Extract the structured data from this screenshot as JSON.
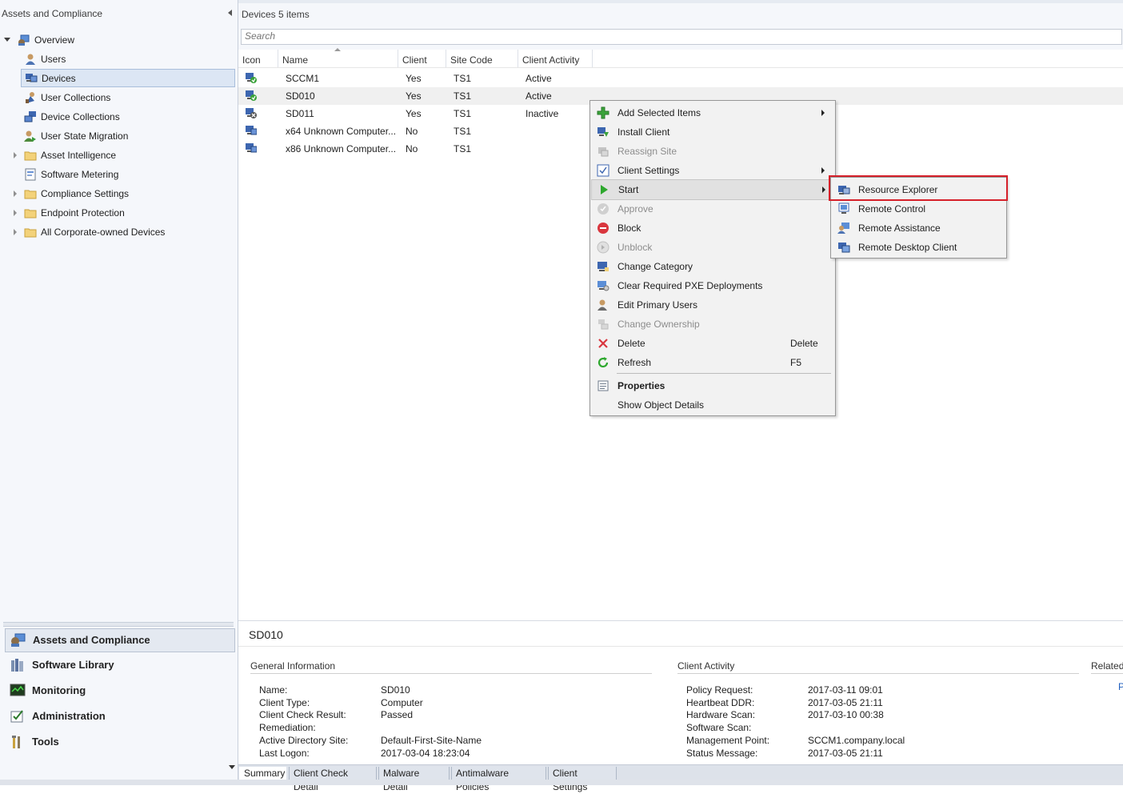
{
  "left_pane": {
    "title": "Assets and Compliance",
    "tree": [
      {
        "label": "Overview",
        "icon": "overview-icon"
      },
      {
        "label": "Users",
        "icon": "user-icon"
      },
      {
        "label": "Devices",
        "icon": "devices-icon",
        "selected": true
      },
      {
        "label": "User Collections",
        "icon": "user-collections-icon"
      },
      {
        "label": "Device Collections",
        "icon": "device-collections-icon"
      },
      {
        "label": "User State Migration",
        "icon": "user-state-migration-icon"
      },
      {
        "label": "Asset Intelligence",
        "icon": "folder-icon"
      },
      {
        "label": "Software Metering",
        "icon": "software-metering-icon"
      },
      {
        "label": "Compliance Settings",
        "icon": "folder-icon"
      },
      {
        "label": "Endpoint Protection",
        "icon": "folder-icon"
      },
      {
        "label": "All Corporate-owned Devices",
        "icon": "folder-icon"
      }
    ]
  },
  "wunderbar": [
    {
      "label": "Assets and Compliance",
      "icon": "assets-compliance-icon",
      "selected": true
    },
    {
      "label": "Software Library",
      "icon": "software-library-icon"
    },
    {
      "label": "Monitoring",
      "icon": "monitoring-icon"
    },
    {
      "label": "Administration",
      "icon": "administration-icon"
    },
    {
      "label": "Tools",
      "icon": "tools-icon"
    }
  ],
  "list": {
    "title": "Devices 5 items",
    "search_placeholder": "Search",
    "columns": [
      "Icon",
      "Name",
      "Client",
      "Site Code",
      "Client Activity"
    ],
    "rows": [
      {
        "name": "SCCM1",
        "client": "Yes",
        "site": "TS1",
        "activity": "Active",
        "icon": "computer-ok-icon"
      },
      {
        "name": "SD010",
        "client": "Yes",
        "site": "TS1",
        "activity": "Active",
        "icon": "computer-ok-icon",
        "selected": true
      },
      {
        "name": "SD011",
        "client": "Yes",
        "site": "TS1",
        "activity": "Inactive",
        "icon": "computer-inactive-icon"
      },
      {
        "name": "x64 Unknown Computer...",
        "client": "No",
        "site": "TS1",
        "activity": "",
        "icon": "computer-icon"
      },
      {
        "name": "x86 Unknown Computer...",
        "client": "No",
        "site": "TS1",
        "activity": "",
        "icon": "computer-icon"
      }
    ]
  },
  "context_menu": {
    "items": [
      {
        "label": "Add Selected Items",
        "icon": "add-icon",
        "submenu": true
      },
      {
        "label": "Install Client",
        "icon": "install-client-icon"
      },
      {
        "label": "Reassign Site",
        "icon": "reassign-site-icon",
        "disabled": true
      },
      {
        "label": "Client Settings",
        "icon": "client-settings-icon",
        "submenu": true
      },
      {
        "label": "Start",
        "icon": "start-icon",
        "submenu": true,
        "highlighted": true
      },
      {
        "label": "Approve",
        "icon": "approve-icon",
        "disabled": true
      },
      {
        "label": "Block",
        "icon": "block-icon"
      },
      {
        "label": "Unblock",
        "icon": "unblock-icon",
        "disabled": true
      },
      {
        "label": "Change Category",
        "icon": "change-category-icon"
      },
      {
        "label": "Clear Required PXE Deployments",
        "icon": "clear-pxe-icon"
      },
      {
        "label": "Edit Primary Users",
        "icon": "edit-users-icon"
      },
      {
        "label": "Change Ownership",
        "icon": "change-ownership-icon",
        "disabled": true
      },
      {
        "label": "Delete",
        "icon": "delete-icon",
        "shortcut": "Delete"
      },
      {
        "label": "Refresh",
        "icon": "refresh-icon",
        "shortcut": "F5"
      },
      {
        "label": "Properties",
        "icon": "properties-icon",
        "bold": true
      },
      {
        "label": "Show Object Details",
        "icon": ""
      }
    ]
  },
  "start_submenu": {
    "items": [
      {
        "label": "Resource Explorer",
        "icon": "resource-explorer-icon",
        "highlighted": true
      },
      {
        "label": "Remote Control",
        "icon": "remote-control-icon"
      },
      {
        "label": "Remote Assistance",
        "icon": "remote-assistance-icon"
      },
      {
        "label": "Remote Desktop Client",
        "icon": "remote-desktop-icon"
      }
    ]
  },
  "details": {
    "title": "SD010",
    "general": {
      "heading": "General Information",
      "fields": [
        {
          "k": "Name:",
          "v": "SD010"
        },
        {
          "k": "Client Type:",
          "v": "Computer"
        },
        {
          "k": "Client Check Result:",
          "v": "Passed"
        },
        {
          "k": "Remediation:",
          "v": ""
        },
        {
          "k": "Active Directory Site:",
          "v": "Default-First-Site-Name"
        },
        {
          "k": "Last Logon:",
          "v": "2017-03-04 18:23:04"
        }
      ]
    },
    "activity": {
      "heading": "Client Activity",
      "fields": [
        {
          "k": "Policy Request:",
          "v": "2017-03-11 09:01"
        },
        {
          "k": "Heartbeat DDR:",
          "v": "2017-03-05 21:11"
        },
        {
          "k": "Hardware Scan:",
          "v": "2017-03-10 00:38"
        },
        {
          "k": "Software Scan:",
          "v": ""
        },
        {
          "k": "Management Point:",
          "v": "SCCM1.company.local"
        },
        {
          "k": "Status Message:",
          "v": "2017-03-05 21:11"
        }
      ]
    },
    "related": {
      "heading": "Related",
      "link": "P"
    },
    "tabs": [
      "Summary",
      "Client Check Detail",
      "Malware Detail",
      "Antimalware Policies",
      "Client Settings"
    ]
  },
  "colors": {
    "highlight_box": "#d6202a",
    "selection": "#dce6f4"
  }
}
